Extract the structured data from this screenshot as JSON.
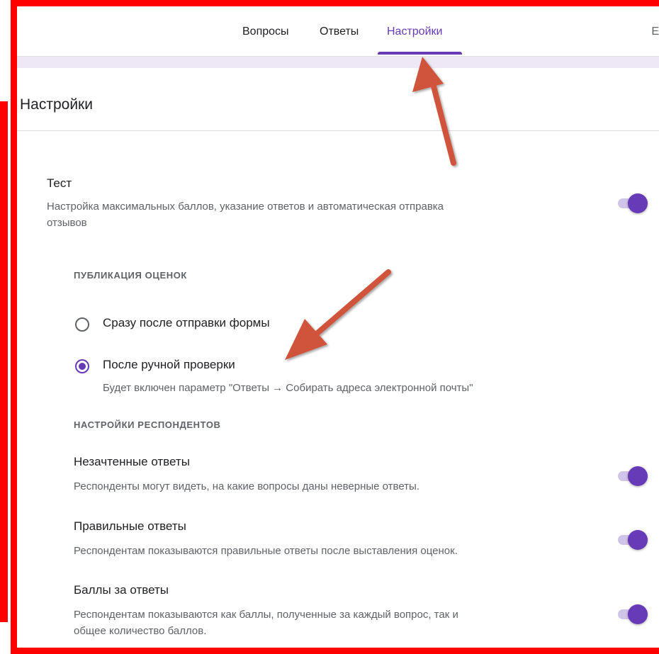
{
  "tabs": [
    {
      "label": "Вопросы",
      "active": false
    },
    {
      "label": "Ответы",
      "active": false
    },
    {
      "label": "Настройки",
      "active": true
    }
  ],
  "edge_letter": "Е",
  "page_title": "Настройки",
  "quiz": {
    "title": "Тест",
    "desc_line1": "Настройка максимальных баллов, указание ответов и автоматическая отправка",
    "desc_line2": "отзывов",
    "enabled": true
  },
  "grade_release": {
    "section_label": "ПУБЛИКАЦИЯ ОЦЕНОК",
    "options": [
      {
        "label": "Сразу после отправки формы",
        "selected": false
      },
      {
        "label": "После ручной проверки",
        "selected": true,
        "hint": "Будет включен параметр \"Ответы → Собирать адреса электронной почты\""
      }
    ]
  },
  "respondent_settings": {
    "section_label": "НАСТРОЙКИ РЕСПОНДЕНТОВ",
    "items": [
      {
        "title": "Незачтенные ответы",
        "desc_line1": "Респонденты могут видеть, на какие вопросы даны неверные ответы.",
        "enabled": true
      },
      {
        "title": "Правильные ответы",
        "desc_line1": "Респондентам показываются правильные ответы после выставления оценок.",
        "enabled": true
      },
      {
        "title": "Баллы за ответы",
        "desc_line1": "Респондентам показываются как баллы, полученные за каждый вопрос, так и",
        "desc_line2": "общее количество баллов.",
        "enabled": true
      }
    ]
  },
  "colors": {
    "accent": "#673ab7",
    "toggle_track": "#d1c4e9",
    "annotation_frame": "#ff0000",
    "annotation_arrow": "#d0533a"
  }
}
